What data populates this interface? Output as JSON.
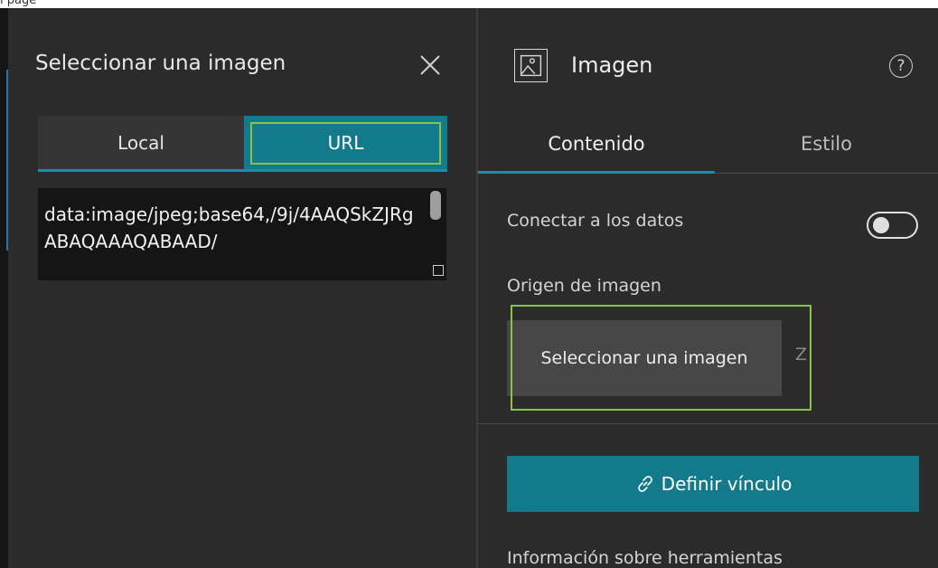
{
  "top_strip": {
    "text": "l page"
  },
  "left_panel": {
    "title": "Seleccionar una imagen",
    "tabs": [
      {
        "label": "Local",
        "selected": false
      },
      {
        "label": "URL",
        "selected": true
      }
    ],
    "url_value": "data:image/jpeg;base64,/9j/4AAQSkZJRgABAQAAAQABAAD/",
    "close_icon": "close-icon"
  },
  "right_panel": {
    "title": "Imagen",
    "header_icon": "image-icon",
    "help_icon": "help-icon",
    "help_glyph": "?",
    "tabs": [
      {
        "label": "Contenido",
        "selected": true
      },
      {
        "label": "Estilo",
        "selected": false
      }
    ],
    "connect_label": "Conectar a los datos",
    "connect_toggle_on": false,
    "origin_label": "Origen de imagen",
    "select_button_label": "Seleccionar una imagen",
    "truncated_text": "Z",
    "link_button_label": "Definir vínculo",
    "link_icon": "link-icon",
    "tooltip_label": "Información sobre herramientas"
  },
  "colors": {
    "accent": "#137a8c",
    "highlight_outline": "#8bc34a",
    "panel_bg": "#2b2b2b"
  }
}
